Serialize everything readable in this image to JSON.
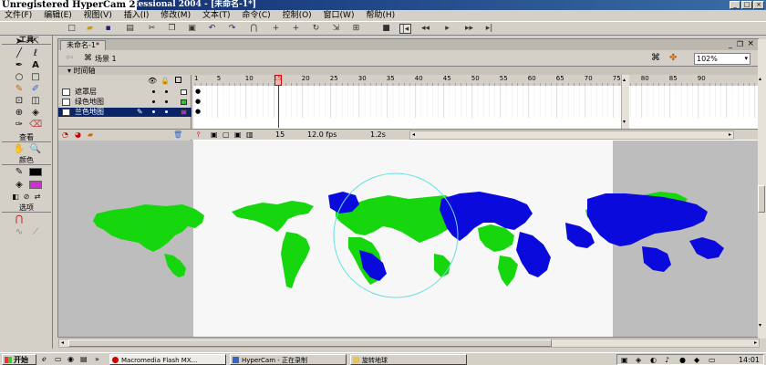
{
  "window": {
    "title": "Unregistered HyperCam 2 rofessional 2004 - [未命名-1*]",
    "watermark": "Unregistered HyperCam 2"
  },
  "menu": [
    "文件(F)",
    "编辑(E)",
    "视图(V)",
    "插入(I)",
    "修改(M)",
    "文本(T)",
    "命令(C)",
    "控制(O)",
    "窗口(W)",
    "帮助(H)"
  ],
  "tools": {
    "header": "工具",
    "view_header": "查看",
    "colors_header": "颜色",
    "options_header": "选项"
  },
  "document": {
    "tab": "未命名-1*",
    "scene": "场景 1",
    "zoom": "102%",
    "timeline_label": "时间轴",
    "layers": [
      {
        "name": "遮罩层",
        "color": "#ffffff"
      },
      {
        "name": "绿色地图",
        "color": "#22cc22"
      },
      {
        "name": "兰色地图",
        "color": "#9933cc"
      }
    ],
    "frame_numbers": [
      "1",
      "5",
      "10",
      "15",
      "20",
      "25",
      "30",
      "35",
      "40",
      "45",
      "50",
      "55",
      "60",
      "65",
      "70",
      "75",
      "80",
      "85",
      "90"
    ],
    "current_frame": "15",
    "fps": "12.0 fps",
    "time": "1.2s"
  },
  "colors": {
    "green_map": "#16d60e",
    "blue_map": "#0a0adc",
    "playhead": "#e00000"
  },
  "taskbar": {
    "start": "开始",
    "tasks": [
      "Macromedia Flash MX...",
      "HyperCam - 正在录制",
      "旋转地球"
    ],
    "clock": "14:01"
  }
}
